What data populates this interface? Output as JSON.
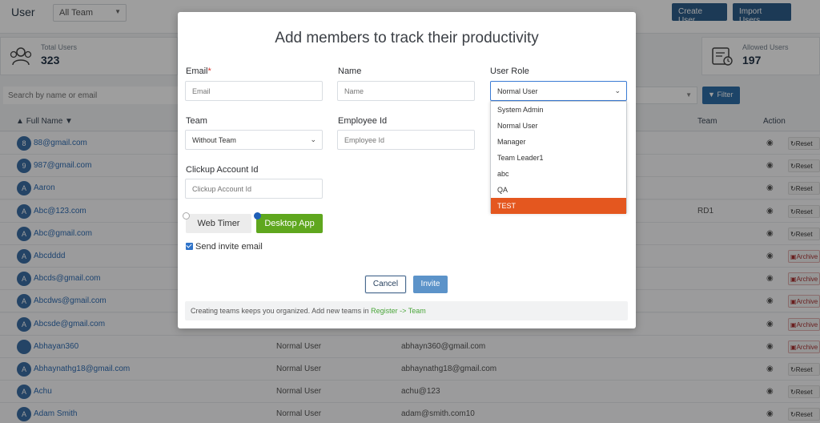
{
  "header": {
    "title": "User",
    "team_filter": "All Team",
    "create_user": "Create User",
    "import_users": "Import Users"
  },
  "stats": {
    "total_label": "Total Users",
    "total_value": "323",
    "allowed_label": "Allowed Users",
    "allowed_value": "197"
  },
  "search": {
    "placeholder": "Search by name or email",
    "filter_label": "Filter"
  },
  "table": {
    "col_fullname": "Full Name",
    "col_team": "Team",
    "col_action": "Action",
    "rows": [
      {
        "initial": "8",
        "name": "88@gmail.com",
        "role": "",
        "email": "",
        "team": "",
        "action": "Reset"
      },
      {
        "initial": "9",
        "name": "987@gmail.com",
        "role": "",
        "email": "",
        "team": "",
        "action": "Reset"
      },
      {
        "initial": "A",
        "name": "Aaron",
        "role": "",
        "email": "",
        "team": "",
        "action": "Reset"
      },
      {
        "initial": "A",
        "name": "Abc@123.com",
        "role": "",
        "email": "",
        "team": "RD1",
        "action": "Reset"
      },
      {
        "initial": "A",
        "name": "Abc@gmail.com",
        "role": "",
        "email": "",
        "team": "",
        "action": "Reset"
      },
      {
        "initial": "A",
        "name": "Abcdddd",
        "role": "",
        "email": "",
        "team": "",
        "action": "Archive"
      },
      {
        "initial": "A",
        "name": "Abcds@gmail.com",
        "role": "",
        "email": "",
        "team": "",
        "action": "Archive"
      },
      {
        "initial": "A",
        "name": "Abcdws@gmail.com",
        "role": "",
        "email": "",
        "team": "",
        "action": "Archive"
      },
      {
        "initial": "A",
        "name": "Abcsde@gmail.com",
        "role": "",
        "email": "",
        "team": "",
        "action": "Archive"
      },
      {
        "initial": "",
        "name": "Abhayan360",
        "role": "Normal User",
        "email": "abhayn360@gmail.com",
        "team": "",
        "action": "Archive"
      },
      {
        "initial": "A",
        "name": "Abhaynathg18@gmail.com",
        "role": "Normal User",
        "email": "abhaynathg18@gmail.com",
        "team": "",
        "action": "Reset"
      },
      {
        "initial": "A",
        "name": "Achu",
        "role": "Normal User",
        "email": "achu@123",
        "team": "",
        "action": "Reset"
      },
      {
        "initial": "A",
        "name": "Adam Smith",
        "role": "Normal User",
        "email": "adam@smith.com10",
        "team": "",
        "action": "Reset"
      }
    ]
  },
  "modal": {
    "title": "Add members to track their productivity",
    "email_label": "Email",
    "email_required": "*",
    "email_placeholder": "Email",
    "name_label": "Name",
    "name_placeholder": "Name",
    "role_label": "User Role",
    "role_value": "Normal User",
    "role_options": [
      "System Admin",
      "Normal User",
      "Manager",
      "Team Leader1",
      "abc",
      "QA",
      "TEST"
    ],
    "team_label": "Team",
    "team_value": "Without Team",
    "employee_label": "Employee Id",
    "employee_placeholder": "Employee Id",
    "clickup_label": "Clickup Account Id",
    "clickup_placeholder": "Clickup Account Id",
    "mode_web": "Web Timer",
    "mode_desktop": "Desktop App",
    "send_invite": "Send invite email",
    "cancel": "Cancel",
    "invite": "Invite",
    "footer_text": "Creating teams keeps you organized. Add new teams in ",
    "footer_link": "Register -> Team"
  },
  "colors": {
    "primary": "#2e5e8c",
    "desktop_active": "#5fa71e",
    "dropdown_highlight": "#e4571f"
  }
}
